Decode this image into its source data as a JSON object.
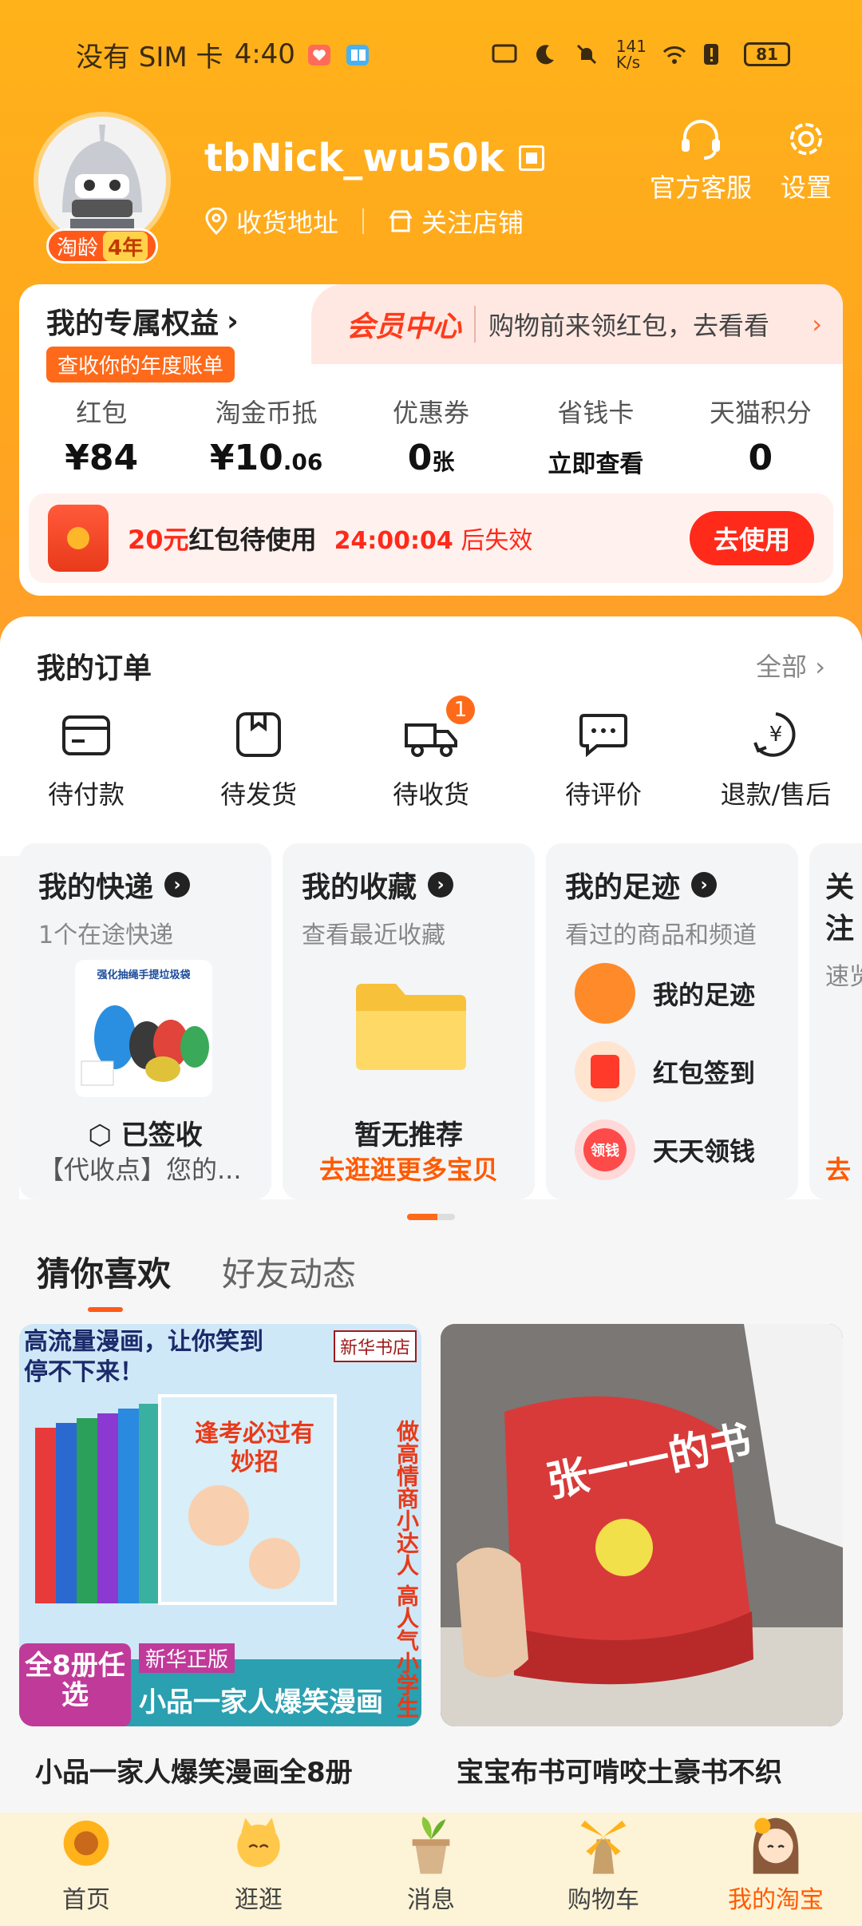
{
  "status_bar": {
    "carrier": "没有 SIM 卡",
    "time": "4:40",
    "net_speed_top": "141",
    "net_speed_bottom": "K/s",
    "battery": "81"
  },
  "profile": {
    "nickname": "tbNick_wu50k",
    "age_label": "淘龄",
    "age_value": "4年",
    "address_label": "收货地址",
    "follow_label": "关注店铺"
  },
  "top_actions": {
    "service_label": "官方客服",
    "settings_label": "设置"
  },
  "benefits": {
    "title": "我的专属权益",
    "bill_label": "查收你的年度账单",
    "vip_label": "会员中心",
    "vip_text": "购物前来领红包，去看看",
    "stats": [
      {
        "label": "红包",
        "value": "¥84"
      },
      {
        "label": "淘金币抵",
        "value_main": "¥10",
        "value_small": ".06"
      },
      {
        "label": "优惠券",
        "value_main": "0",
        "value_small": "张"
      },
      {
        "label": "省钱卡",
        "value": "立即查看"
      },
      {
        "label": "天猫积分",
        "value": "0"
      }
    ],
    "coupon": {
      "amount": "20元",
      "text": "红包待使用",
      "timer": "24:00:04",
      "suffix": "后失效",
      "button": "去使用"
    }
  },
  "orders": {
    "title": "我的订单",
    "all_label": "全部",
    "items": [
      {
        "label": "待付款"
      },
      {
        "label": "待发货"
      },
      {
        "label": "待收货",
        "badge": "1"
      },
      {
        "label": "待评价"
      },
      {
        "label": "退款/售后"
      }
    ]
  },
  "cards": {
    "express": {
      "title": "我的快递",
      "desc": "1个在途快递",
      "product_caption": "强化抽绳手提垃圾袋",
      "status": "已签收",
      "note": "【代收点】您的..."
    },
    "favorites": {
      "title": "我的收藏",
      "desc": "查看最近收藏",
      "empty": "暂无推荐",
      "link": "去逛逛更多宝贝"
    },
    "footprints": {
      "title": "我的足迹",
      "desc": "看过的商品和频道",
      "items": [
        {
          "label": "我的足迹"
        },
        {
          "label": "红包签到"
        },
        {
          "label": "天天领钱",
          "icon_text": "领钱"
        }
      ]
    },
    "partial": {
      "title": "关注",
      "desc": "速览",
      "link": "去"
    }
  },
  "recommend": {
    "tabs": [
      "猜你喜欢",
      "好友动态"
    ],
    "products": [
      {
        "title": "小品一家人爆笑漫画全8册",
        "img_headline": "高流量漫画，让你笑到停不下来！",
        "img_store": "新华书店",
        "img_book_title": "逢考必过有妙招",
        "img_side": "做高情商小达人 高人气小学生",
        "img_count": "全8册任选",
        "img_edition": "新华正版",
        "img_bottom": "小品一家人爆笑漫画"
      },
      {
        "title": "宝宝布书可啃咬土豪书不织",
        "img_text": "张一一的书"
      }
    ]
  },
  "tabbar": [
    {
      "label": "首页"
    },
    {
      "label": "逛逛"
    },
    {
      "label": "消息"
    },
    {
      "label": "购物车"
    },
    {
      "label": "我的淘宝",
      "active": true
    }
  ],
  "colors": {
    "brand": "#ff5a00",
    "header": "#ffa61e",
    "red": "#ff2a1a"
  }
}
